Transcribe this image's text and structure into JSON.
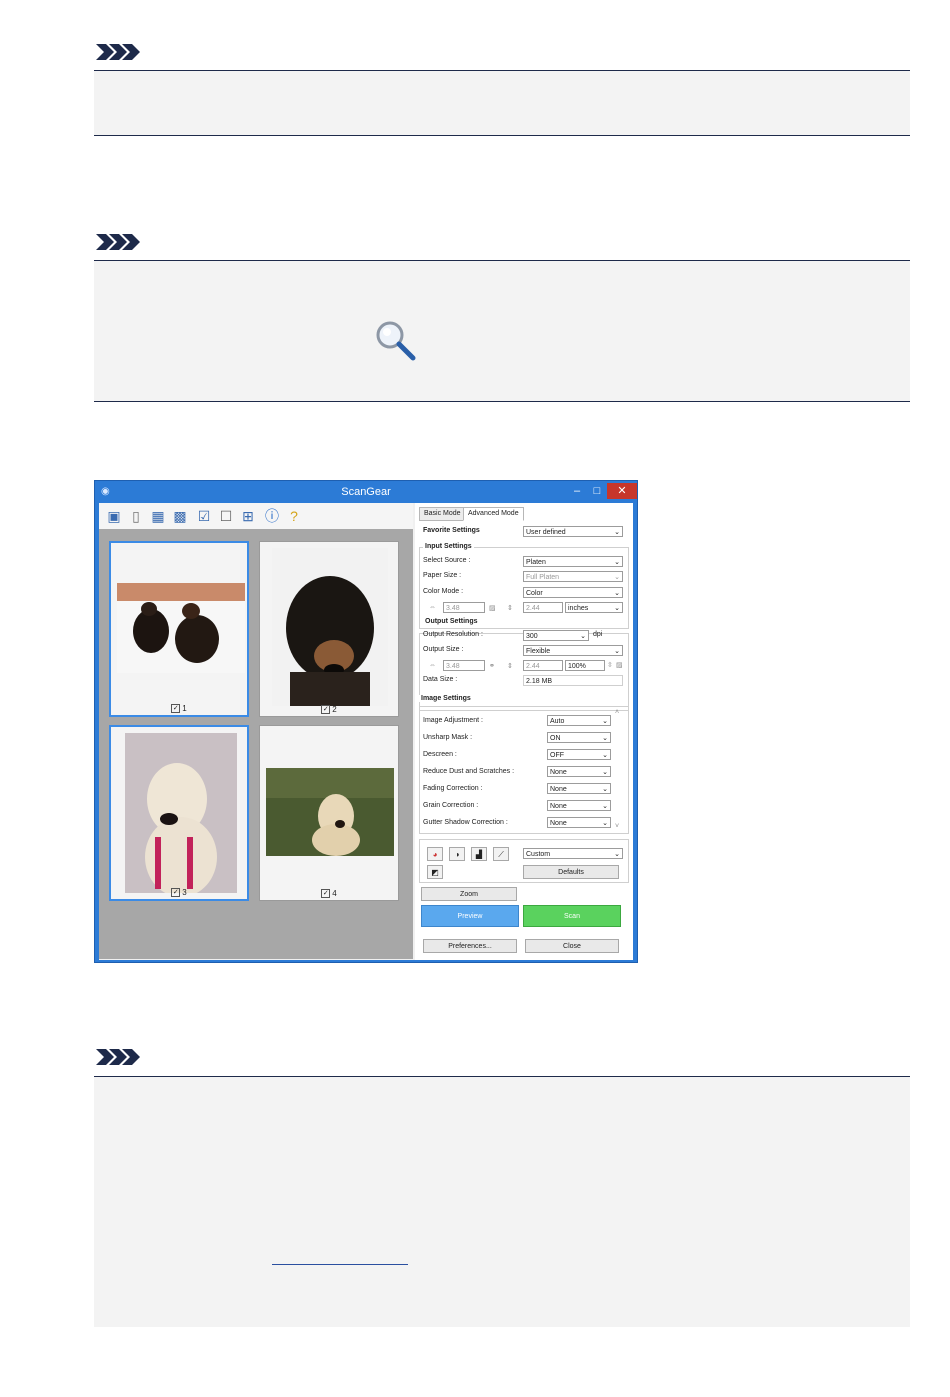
{
  "window": {
    "title": "ScanGear",
    "minimize": "–",
    "maximize": "□",
    "close": "✕"
  },
  "thumbnails": [
    {
      "number": "1",
      "checked": true
    },
    {
      "number": "2",
      "checked": true
    },
    {
      "number": "3",
      "checked": true
    },
    {
      "number": "4",
      "checked": true
    }
  ],
  "tabs": {
    "basic": "Basic Mode",
    "advanced": "Advanced Mode"
  },
  "favorite": {
    "label": "Favorite Settings",
    "value": "User defined"
  },
  "input_settings": {
    "title": "Input Settings",
    "select_source_label": "Select Source :",
    "select_source_value": "Platen",
    "paper_size_label": "Paper Size :",
    "paper_size_value": "Full Platen",
    "color_mode_label": "Color Mode :",
    "color_mode_value": "Color",
    "width": "3.48",
    "height": "2.44",
    "unit": "inches"
  },
  "output_settings": {
    "title": "Output Settings",
    "resolution_label": "Output Resolution :",
    "resolution_value": "300",
    "resolution_unit": "dpi",
    "size_label": "Output Size :",
    "size_value": "Flexible",
    "width": "3.48",
    "height": "2.44",
    "scale": "100%",
    "data_size_label": "Data Size :",
    "data_size_value": "2.18 MB"
  },
  "image_settings": {
    "title": "Image Settings",
    "rows": [
      {
        "label": "Image Adjustment :",
        "value": "Auto"
      },
      {
        "label": "Unsharp Mask :",
        "value": "ON"
      },
      {
        "label": "Descreen :",
        "value": "OFF"
      },
      {
        "label": "Reduce Dust and Scratches :",
        "value": "None"
      },
      {
        "label": "Fading Correction :",
        "value": "None"
      },
      {
        "label": "Grain Correction :",
        "value": "None"
      },
      {
        "label": "Gutter Shadow Correction :",
        "value": "None"
      }
    ]
  },
  "color_adjust": {
    "value": "Custom",
    "defaults": "Defaults"
  },
  "buttons": {
    "zoom": "Zoom",
    "preview": "Preview",
    "scan": "Scan",
    "preferences": "Preferences...",
    "close": "Close"
  },
  "icons": {
    "note": "note-arrows-icon",
    "zoom": "magnifier-icon",
    "app": "scangear-app-icon"
  },
  "colors": {
    "titlebar": "#2c7bd6",
    "thumb_selected": "#3b8be6",
    "preview_button": "#5aa8ee",
    "scan_button": "#5ad25e",
    "rule": "#1e2a4a"
  }
}
